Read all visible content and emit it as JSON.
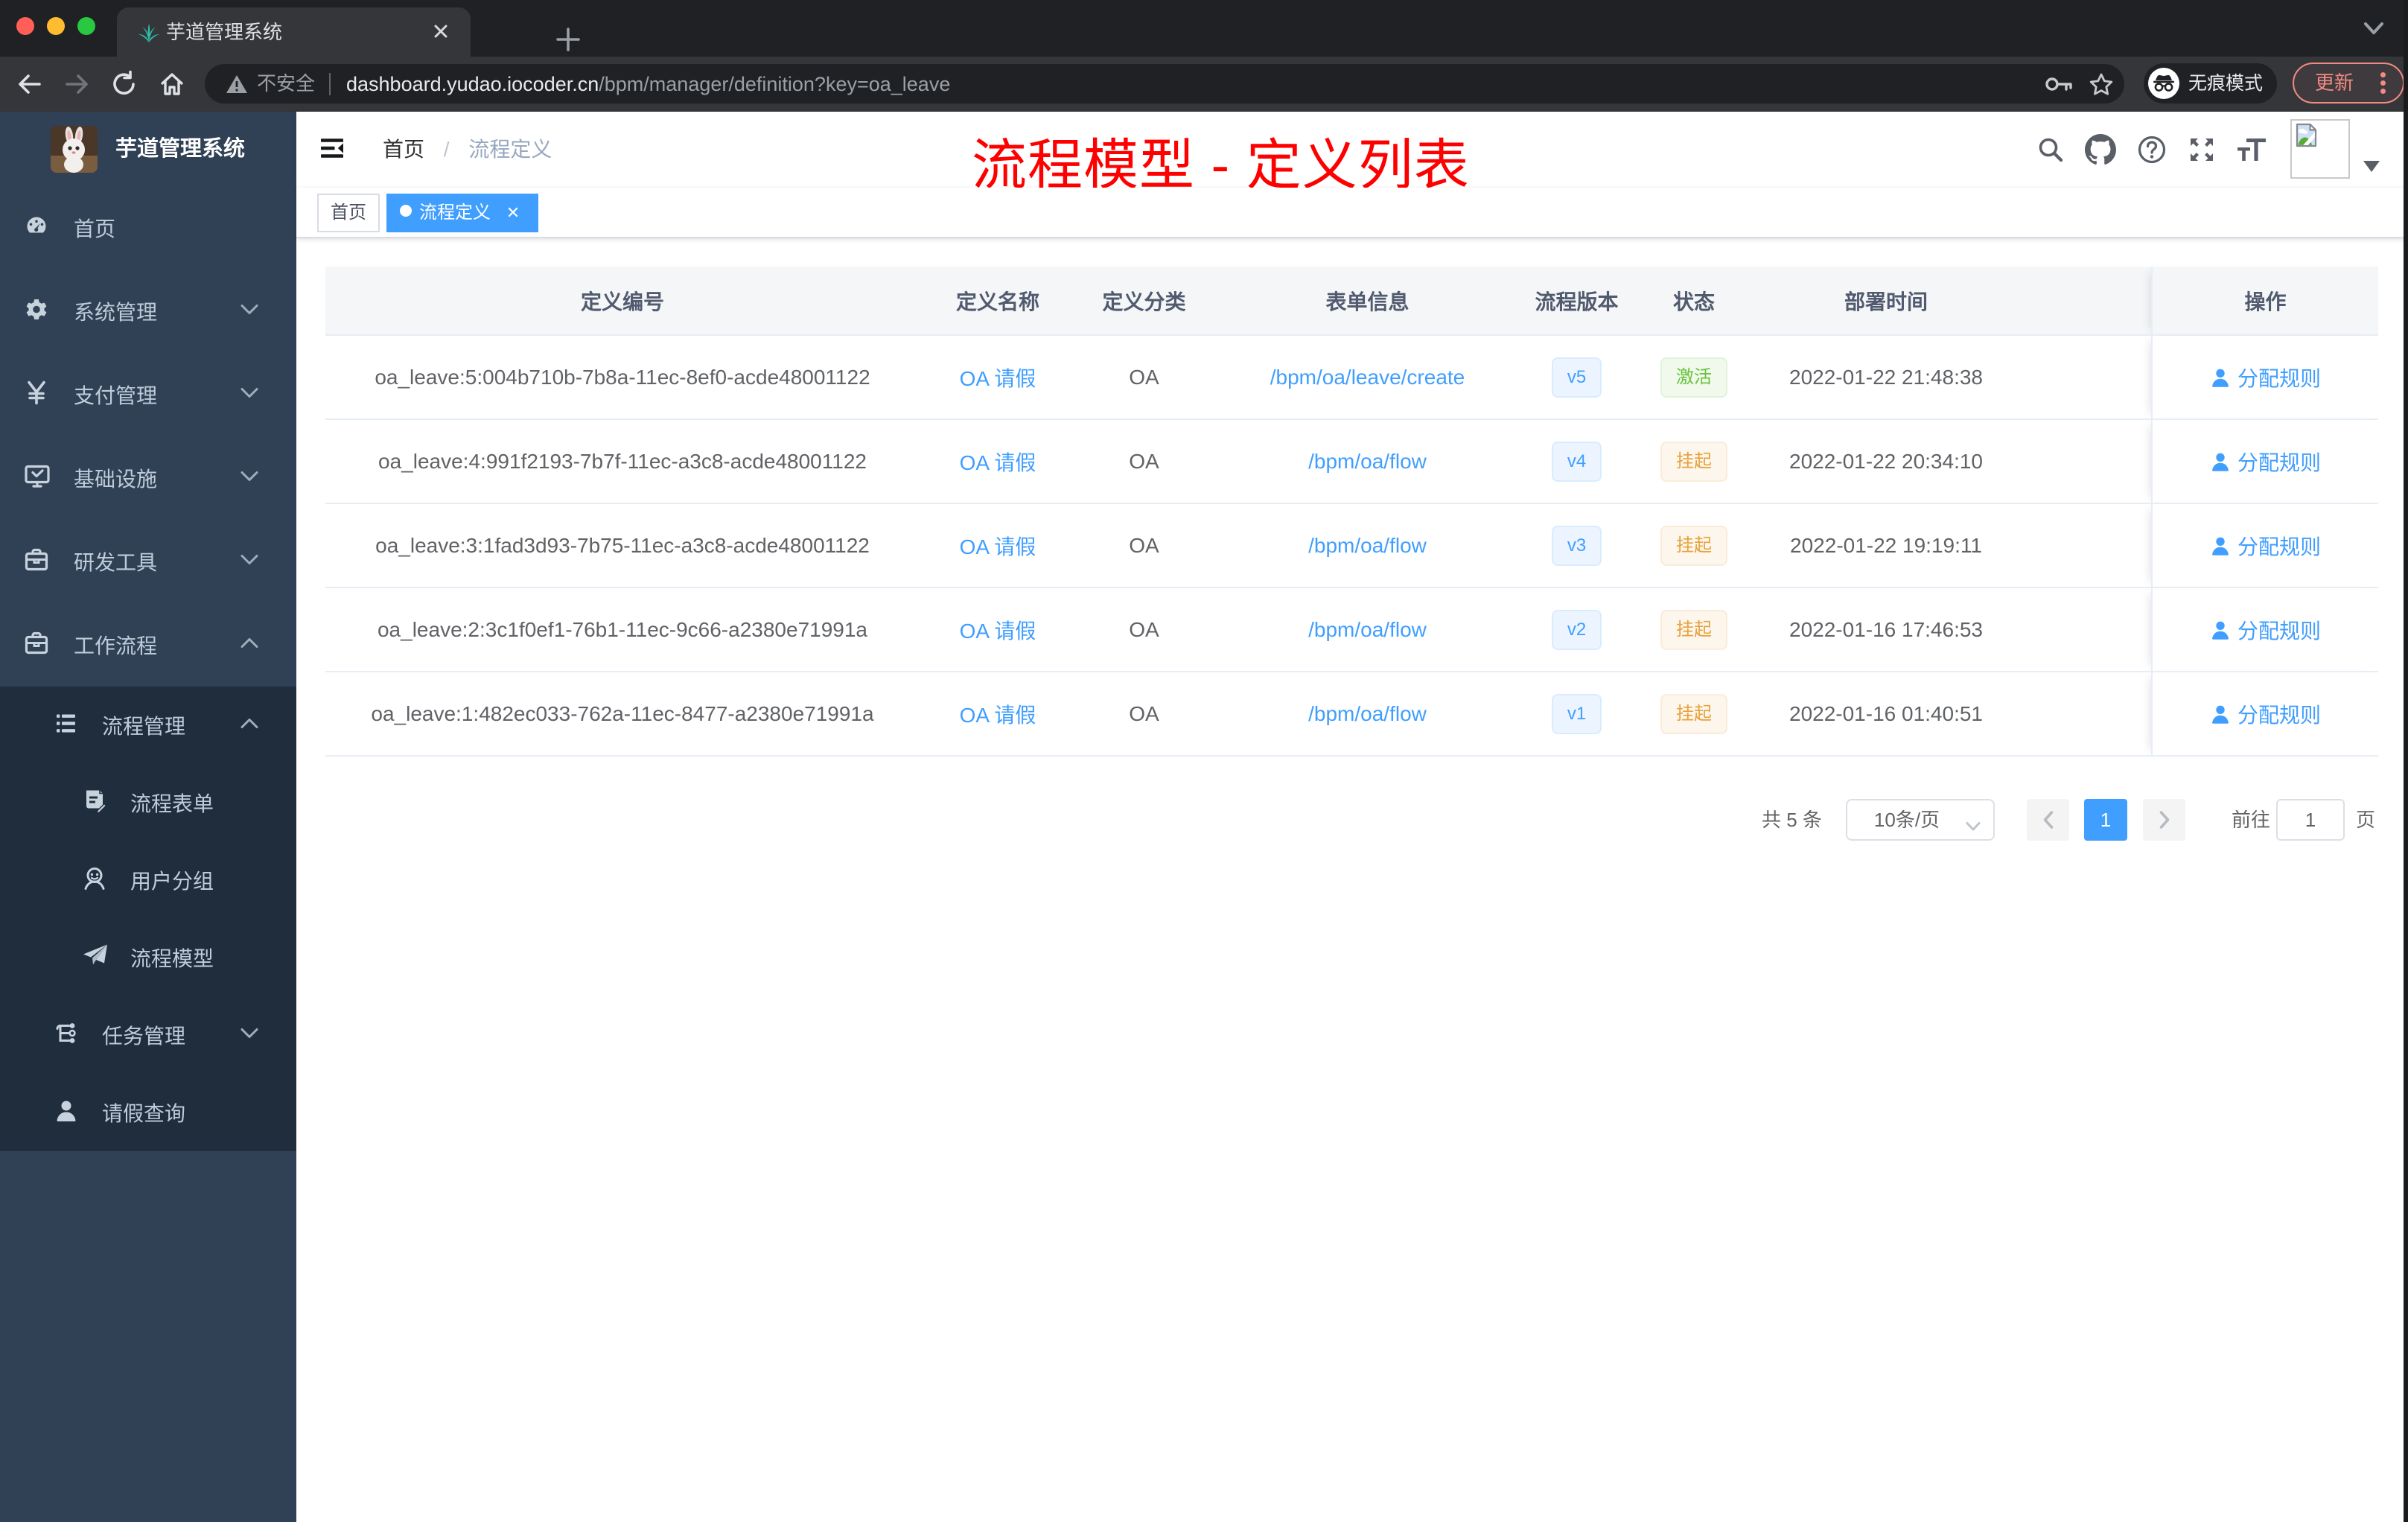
{
  "colors": {
    "accent": "#409eff",
    "annotation-red": "#ff0000",
    "chrome-dark": "#202124",
    "chrome-mid": "#35363a",
    "menu-bg": "#304156",
    "submenu-bg": "#1f2d3d",
    "menu-text": "#bfcbd9",
    "th-bg": "#f4f6f8",
    "th-text": "#515a6e",
    "tbl-border": "#e7edf4",
    "text-regular": "#606266",
    "status-active-green": "#67c23a",
    "status-suspend-orange": "#e6a23c"
  },
  "browser": {
    "tab_title": "芋道管理系统",
    "security_label": "不安全",
    "url_domain": "dashboard.yudao.iocoder.cn",
    "url_path": "/bpm/manager/definition?key=oa_leave",
    "incognito_label": "无痕模式",
    "update_label": "更新"
  },
  "sidebar": {
    "logo_title": "芋道管理系统",
    "items": [
      {
        "label": "首页"
      },
      {
        "label": "系统管理"
      },
      {
        "label": "支付管理"
      },
      {
        "label": "基础设施"
      },
      {
        "label": "研发工具"
      },
      {
        "label": "工作流程"
      },
      {
        "label": "流程管理"
      },
      {
        "label": "流程表单"
      },
      {
        "label": "用户分组"
      },
      {
        "label": "流程模型"
      },
      {
        "label": "任务管理"
      },
      {
        "label": "请假查询"
      }
    ]
  },
  "navbar": {
    "breadcrumb_home": "首页",
    "breadcrumb_current": "流程定义"
  },
  "annotation": "流程模型 - 定义列表",
  "tags": {
    "home": "首页",
    "active": "流程定义"
  },
  "table": {
    "columns": [
      "定义编号",
      "定义名称",
      "定义分类",
      "表单信息",
      "流程版本",
      "状态",
      "部署时间",
      "操作"
    ],
    "action_label": "分配规则",
    "rows": [
      {
        "id": "oa_leave:5:004b710b-7b8a-11ec-8ef0-acde48001122",
        "name": "OA 请假",
        "category": "OA",
        "form": "/bpm/oa/leave/create",
        "version": "v5",
        "status": "激活",
        "time": "2022-01-22 21:48:38"
      },
      {
        "id": "oa_leave:4:991f2193-7b7f-11ec-a3c8-acde48001122",
        "name": "OA 请假",
        "category": "OA",
        "form": "/bpm/oa/flow",
        "version": "v4",
        "status": "挂起",
        "time": "2022-01-22 20:34:10"
      },
      {
        "id": "oa_leave:3:1fad3d93-7b75-11ec-a3c8-acde48001122",
        "name": "OA 请假",
        "category": "OA",
        "form": "/bpm/oa/flow",
        "version": "v3",
        "status": "挂起",
        "time": "2022-01-22 19:19:11"
      },
      {
        "id": "oa_leave:2:3c1f0ef1-76b1-11ec-9c66-a2380e71991a",
        "name": "OA 请假",
        "category": "OA",
        "form": "/bpm/oa/flow",
        "version": "v2",
        "status": "挂起",
        "time": "2022-01-16 17:46:53"
      },
      {
        "id": "oa_leave:1:482ec033-762a-11ec-8477-a2380e71991a",
        "name": "OA 请假",
        "category": "OA",
        "form": "/bpm/oa/flow",
        "version": "v1",
        "status": "挂起",
        "time": "2022-01-16 01:40:51"
      }
    ]
  },
  "pagination": {
    "total": "共 5 条",
    "page_size": "10条/页",
    "current_page": "1",
    "goto_label": "前往",
    "page_unit": "页"
  }
}
